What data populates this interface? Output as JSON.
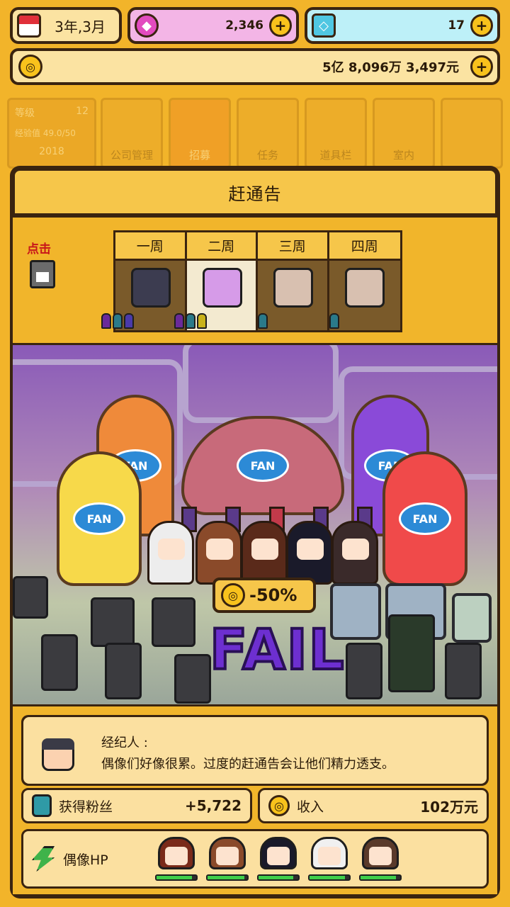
{
  "topbar": {
    "date": "3年,3月",
    "gems": "2,346",
    "diamonds": "17",
    "money": "5亿 8,096万 3,497元",
    "plus": "+"
  },
  "background_menu": {
    "level_label": "等级",
    "level_value": "12",
    "exp_label": "经验值 49.0/50",
    "date_text": "2018",
    "tiles": [
      "公司管理",
      "招募",
      "任务",
      "道具栏",
      "室内"
    ]
  },
  "panel": {
    "title": "赶通告",
    "click_hint": "点击",
    "weeks": [
      "一周",
      "二周",
      "三周",
      "四周"
    ],
    "active_week": 1
  },
  "scene": {
    "bottle_logo": "FAN",
    "penalty": "-50%",
    "result": "FAIL"
  },
  "dialog": {
    "speaker": "经纪人 :",
    "text": "偶像们好像很累。过度的赶通告会让他们精力透支。"
  },
  "stats": {
    "fans_label": "获得粉丝",
    "fans_value": "+5,722",
    "income_label": "收入",
    "income_value": "102万元",
    "hp_label": "偶像HP",
    "idol_hp": [
      0.9,
      0.92,
      0.88,
      0.9,
      0.9
    ],
    "idol_hair_colors": [
      "#7a2a1a",
      "#8a4a2a",
      "#1a1a2a",
      "#f0f0f0",
      "#5a3a2a"
    ]
  },
  "colors": {
    "background": "#f2b42a",
    "panel_cream": "#fbe0a0",
    "outline": "#3a2410",
    "fail_purple": "#6d2fd0",
    "hp_green": "#3fce4a"
  }
}
